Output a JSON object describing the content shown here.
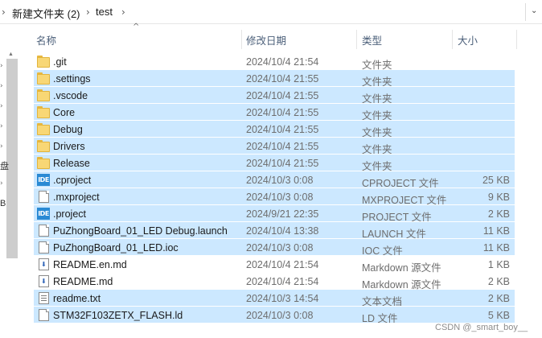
{
  "breadcrumb": {
    "items": [
      "新建文件夹 (2)",
      "test"
    ]
  },
  "nav_pane": {
    "labels": [
      "盘",
      "B"
    ]
  },
  "columns": {
    "name": "名称",
    "date": "修改日期",
    "type": "类型",
    "size": "大小"
  },
  "files": [
    {
      "name": ".git",
      "date": "2024/10/4 21:54",
      "type": "文件夹",
      "size": "",
      "icon": "folder-icon",
      "selected": false
    },
    {
      "name": ".settings",
      "date": "2024/10/4 21:55",
      "type": "文件夹",
      "size": "",
      "icon": "folder-icon",
      "selected": true
    },
    {
      "name": ".vscode",
      "date": "2024/10/4 21:55",
      "type": "文件夹",
      "size": "",
      "icon": "folder-icon",
      "selected": true
    },
    {
      "name": "Core",
      "date": "2024/10/4 21:55",
      "type": "文件夹",
      "size": "",
      "icon": "folder-icon",
      "selected": true
    },
    {
      "name": "Debug",
      "date": "2024/10/4 21:55",
      "type": "文件夹",
      "size": "",
      "icon": "folder-icon",
      "selected": true
    },
    {
      "name": "Drivers",
      "date": "2024/10/4 21:55",
      "type": "文件夹",
      "size": "",
      "icon": "folder-icon",
      "selected": true
    },
    {
      "name": "Release",
      "date": "2024/10/4 21:55",
      "type": "文件夹",
      "size": "",
      "icon": "folder-icon",
      "selected": true
    },
    {
      "name": ".cproject",
      "date": "2024/10/3 0:08",
      "type": "CPROJECT 文件",
      "size": "25 KB",
      "icon": "ide-icon",
      "selected": true
    },
    {
      "name": ".mxproject",
      "date": "2024/10/3 0:08",
      "type": "MXPROJECT 文件",
      "size": "9 KB",
      "icon": "document-icon",
      "selected": true
    },
    {
      "name": ".project",
      "date": "2024/9/21 22:35",
      "type": "PROJECT 文件",
      "size": "2 KB",
      "icon": "ide-icon",
      "selected": true
    },
    {
      "name": "PuZhongBoard_01_LED Debug.launch",
      "date": "2024/10/4 13:38",
      "type": "LAUNCH 文件",
      "size": "11 KB",
      "icon": "document-icon",
      "selected": true
    },
    {
      "name": "PuZhongBoard_01_LED.ioc",
      "date": "2024/10/3 0:08",
      "type": "IOC 文件",
      "size": "11 KB",
      "icon": "document-icon",
      "selected": true
    },
    {
      "name": "README.en.md",
      "date": "2024/10/4 21:54",
      "type": "Markdown 源文件",
      "size": "1 KB",
      "icon": "markdown-icon",
      "selected": false
    },
    {
      "name": "README.md",
      "date": "2024/10/4 21:54",
      "type": "Markdown 源文件",
      "size": "2 KB",
      "icon": "markdown-icon",
      "selected": false
    },
    {
      "name": "readme.txt",
      "date": "2024/10/3 14:54",
      "type": "文本文档",
      "size": "2 KB",
      "icon": "text-file-icon",
      "selected": true
    },
    {
      "name": "STM32F103ZETX_FLASH.ld",
      "date": "2024/10/3 0:08",
      "type": "LD 文件",
      "size": "5 KB",
      "icon": "document-icon",
      "selected": true
    }
  ],
  "ide_icon_text": "IDE",
  "watermark": "CSDN @_smart_boy__",
  "colors": {
    "selection": "#cce8ff",
    "folder": "#f8d775",
    "ide_icon": "#2a8ad4",
    "header_text": "#4c607a"
  }
}
